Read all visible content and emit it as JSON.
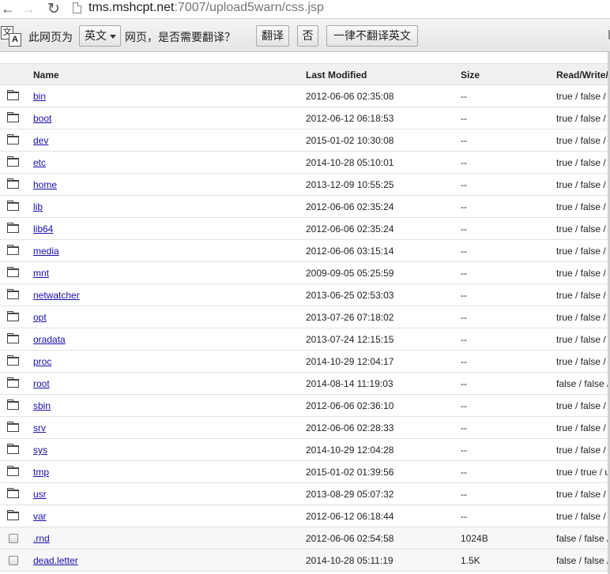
{
  "address_bar": {
    "url_host": "tms.mshcpt.net",
    "url_rest": ":7007/upload5warn/css.jsp"
  },
  "translate_bar": {
    "page_is_label": "此网页为",
    "language": "英文",
    "question": "网页，是否需要翻译？",
    "translate_button": "翻译",
    "no_button": "否",
    "never_button": "一律不翻译英文"
  },
  "table": {
    "columns": [
      "Name",
      "Last Modified",
      "Size",
      "Read/Write/I"
    ],
    "rows": [
      {
        "name": "bin",
        "modified": "2012-06-06 02:35:08",
        "size": "--",
        "perm": "true / false / t",
        "type": "folder"
      },
      {
        "name": "boot",
        "modified": "2012-06-12 06:18:53",
        "size": "--",
        "perm": "true / false / t",
        "type": "folder"
      },
      {
        "name": "dev",
        "modified": "2015-01-02 10:30:08",
        "size": "--",
        "perm": "true / false / t",
        "type": "folder"
      },
      {
        "name": "etc",
        "modified": "2014-10-28 05:10:01",
        "size": "--",
        "perm": "true / false / t",
        "type": "folder"
      },
      {
        "name": "home",
        "modified": "2013-12-09 10:55:25",
        "size": "--",
        "perm": "true / false / t",
        "type": "folder"
      },
      {
        "name": "lib",
        "modified": "2012-06-06 02:35:24",
        "size": "--",
        "perm": "true / false / t",
        "type": "folder"
      },
      {
        "name": "lib64",
        "modified": "2012-06-06 02:35:24",
        "size": "--",
        "perm": "true / false / t",
        "type": "folder"
      },
      {
        "name": "media",
        "modified": "2012-06-06 03:15:14",
        "size": "--",
        "perm": "true / false / t",
        "type": "folder"
      },
      {
        "name": "mnt",
        "modified": "2009-09-05 05:25:59",
        "size": "--",
        "perm": "true / false / t",
        "type": "folder"
      },
      {
        "name": "netwatcher",
        "modified": "2013-06-25 02:53:03",
        "size": "--",
        "perm": "true / false / t",
        "type": "folder"
      },
      {
        "name": "opt",
        "modified": "2013-07-26 07:18:02",
        "size": "--",
        "perm": "true / false / t",
        "type": "folder"
      },
      {
        "name": "oradata",
        "modified": "2013-07-24 12:15:15",
        "size": "--",
        "perm": "true / false / t",
        "type": "folder"
      },
      {
        "name": "proc",
        "modified": "2014-10-29 12:04:17",
        "size": "--",
        "perm": "true / false / t",
        "type": "folder"
      },
      {
        "name": "root",
        "modified": "2014-08-14 11:19:03",
        "size": "--",
        "perm": "false / false / f",
        "type": "folder"
      },
      {
        "name": "sbin",
        "modified": "2012-06-06 02:36:10",
        "size": "--",
        "perm": "true / false / t",
        "type": "folder"
      },
      {
        "name": "srv",
        "modified": "2012-06-06 02:28:33",
        "size": "--",
        "perm": "true / false / t",
        "type": "folder"
      },
      {
        "name": "sys",
        "modified": "2014-10-29 12:04:28",
        "size": "--",
        "perm": "true / false / t",
        "type": "folder"
      },
      {
        "name": "tmp",
        "modified": "2015-01-02 01:39:56",
        "size": "--",
        "perm": "true / true / u",
        "type": "folder"
      },
      {
        "name": "usr",
        "modified": "2013-08-29 05:07:32",
        "size": "--",
        "perm": "true / false / t",
        "type": "folder"
      },
      {
        "name": "var",
        "modified": "2012-06-12 06:18:44",
        "size": "--",
        "perm": "true / false / t",
        "type": "folder"
      },
      {
        "name": ".rnd",
        "modified": "2012-06-06 02:54:58",
        "size": "1024B",
        "perm": "false / false / f",
        "type": "file"
      },
      {
        "name": "dead.letter",
        "modified": "2014-10-28 05:11:19",
        "size": "1.5K",
        "perm": "false / false / f",
        "type": "file"
      }
    ]
  }
}
